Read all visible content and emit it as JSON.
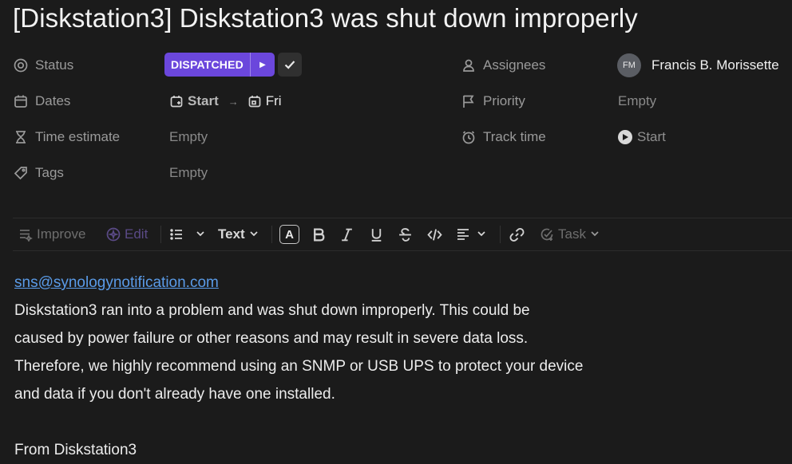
{
  "task": {
    "title": "[Diskstation3] Diskstation3 was shut down improperly"
  },
  "properties": {
    "status": {
      "label": "Status",
      "value": "DISPATCHED",
      "color": "#6b47dc"
    },
    "dates": {
      "label": "Dates",
      "start": "Start",
      "end": "Fri"
    },
    "time_estimate": {
      "label": "Time estimate",
      "value": "Empty"
    },
    "tags": {
      "label": "Tags",
      "value": "Empty"
    },
    "assignees": {
      "label": "Assignees",
      "initials": "FM",
      "name": "Francis B. Morissette"
    },
    "priority": {
      "label": "Priority",
      "value": "Empty"
    },
    "track_time": {
      "label": "Track time",
      "value": "Start"
    }
  },
  "toolbar": {
    "improve": "Improve",
    "edit": "Edit",
    "text_style": "Text",
    "text_color": "A",
    "task": "Task"
  },
  "content": {
    "email": "sns@synologynotification.com",
    "lines": [
      "Diskstation3 ran into a problem and was shut down improperly. This could be",
      "caused by power failure or other reasons and may result in severe data loss.",
      "Therefore, we highly recommend using an SNMP or USB UPS to protect your device",
      "and data if you don't already have one installed."
    ],
    "signature": "From Diskstation3"
  }
}
